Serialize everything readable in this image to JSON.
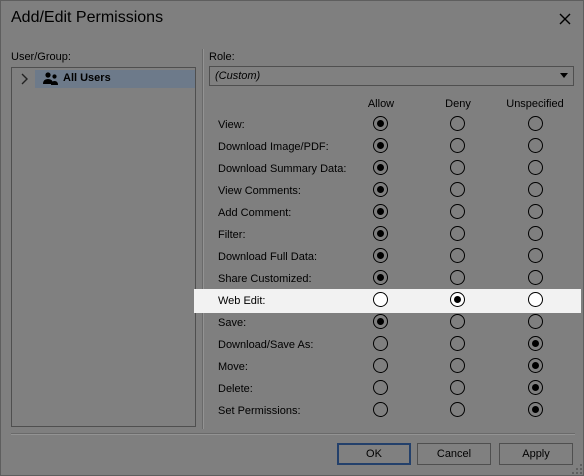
{
  "dialog": {
    "title": "Add/Edit Permissions"
  },
  "left_panel": {
    "label": "User/Group:"
  },
  "tree": {
    "items": [
      {
        "label": "All Users",
        "icon": "users-icon",
        "selected": true
      }
    ]
  },
  "role": {
    "label": "Role:",
    "value": "(Custom)"
  },
  "columns": [
    "Allow",
    "Deny",
    "Unspecified"
  ],
  "permissions": [
    {
      "label": "View:",
      "value": "Allow"
    },
    {
      "label": "Download Image/PDF:",
      "value": "Allow"
    },
    {
      "label": "Download Summary Data:",
      "value": "Allow"
    },
    {
      "label": "View Comments:",
      "value": "Allow"
    },
    {
      "label": "Add Comment:",
      "value": "Allow"
    },
    {
      "label": "Filter:",
      "value": "Allow"
    },
    {
      "label": "Download Full Data:",
      "value": "Allow"
    },
    {
      "label": "Share Customized:",
      "value": "Allow"
    },
    {
      "label": "Web Edit:",
      "value": "Deny",
      "highlighted": true
    },
    {
      "label": "Save:",
      "value": "Allow"
    },
    {
      "label": "Download/Save As:",
      "value": "Unspecified"
    },
    {
      "label": "Move:",
      "value": "Unspecified"
    },
    {
      "label": "Delete:",
      "value": "Unspecified"
    },
    {
      "label": "Set Permissions:",
      "value": "Unspecified"
    }
  ],
  "buttons": {
    "ok": "OK",
    "cancel": "Cancel",
    "apply": "Apply"
  },
  "colors": {
    "highlight_row": "#f2f2f2",
    "selection": "#6d7a8a",
    "default_button_border": "#23406b"
  }
}
